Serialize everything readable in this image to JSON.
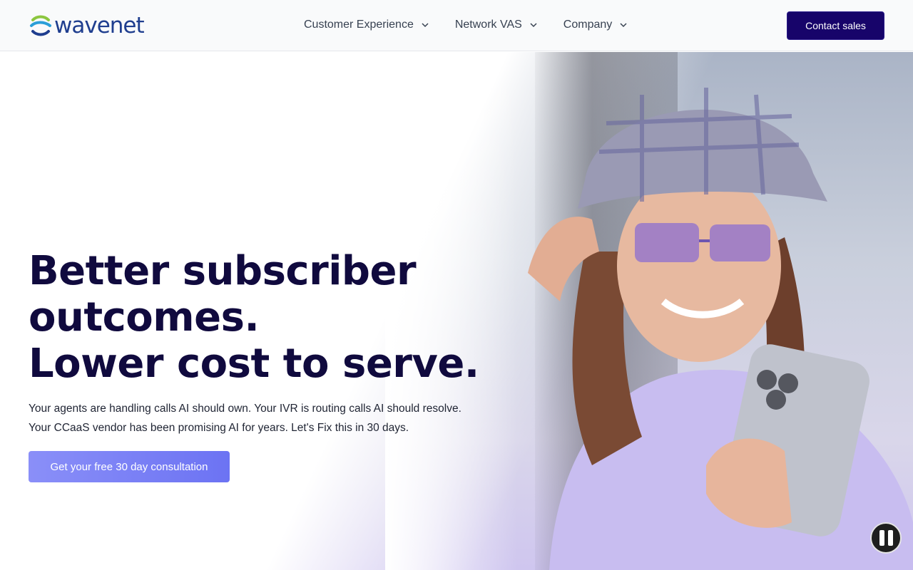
{
  "brand": {
    "name": "wavenet"
  },
  "nav": {
    "items": [
      {
        "label": "Customer Experience"
      },
      {
        "label": "Network VAS"
      },
      {
        "label": "Company"
      }
    ],
    "contact_label": "Contact sales"
  },
  "hero": {
    "headline": [
      "Better subscriber",
      "outcomes.",
      "Lower cost to serve."
    ],
    "subtext": [
      "Your agents are handling calls AI should own. Your IVR is routing calls AI should resolve.",
      "Your CCaaS vendor has been promising AI for years. Let's Fix this in 30 days."
    ],
    "cta_label": "Get your free 30 day consultation"
  },
  "media": {
    "control": "pause"
  },
  "colors": {
    "primary": "#17046a",
    "headline": "#100a3e",
    "cta": "#7a80f6",
    "logo": "#1f3e8f"
  }
}
